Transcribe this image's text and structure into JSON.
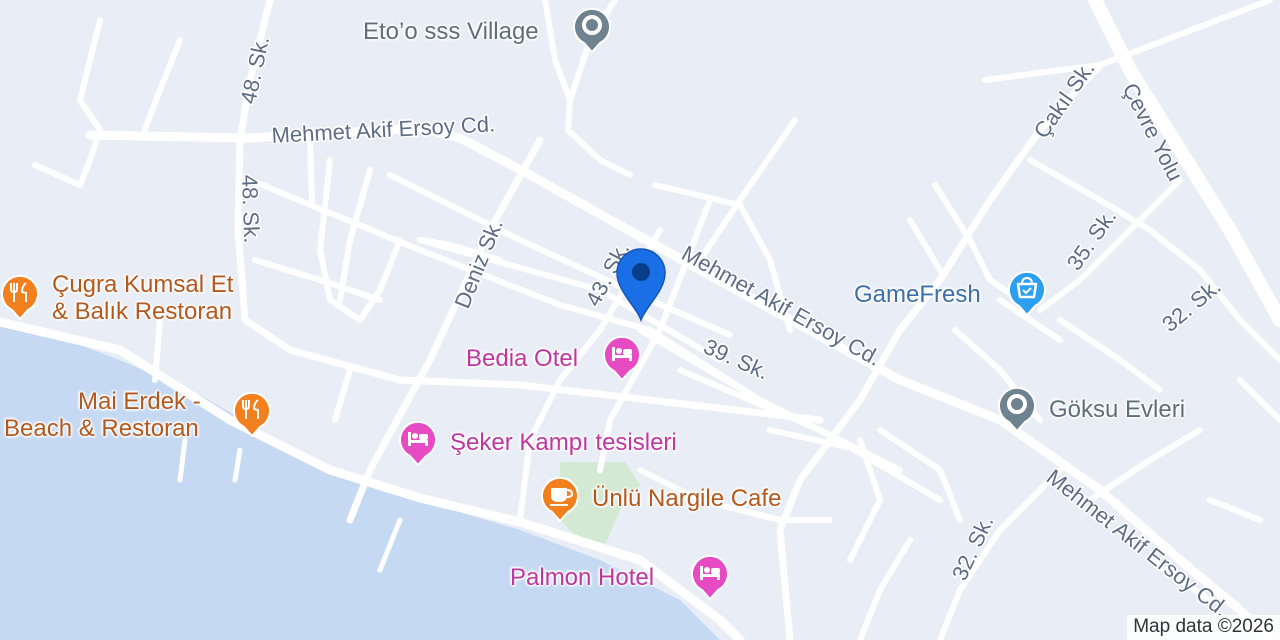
{
  "map": {
    "colors": {
      "land": "#e9edf5",
      "water": "#c6d9f3",
      "road": "#ffffff",
      "park": "#d3e9d4",
      "road_label": "#5d6d85",
      "restaurant": "#f2801f",
      "hotel": "#e64bc4",
      "landmark": "#6f828f",
      "shopping": "#2d9ff0",
      "marker": "#1a6fe6"
    },
    "road_labels": {
      "mehmet_akif_1": "Mehmet Akif Ersoy Cd.",
      "mehmet_akif_2": "Mehmet Akif Ersoy Cd.",
      "mehmet_akif_3": "Mehmet Akif Ersoy Cd.",
      "cevre_yolu": "Çevre Yolu",
      "cakil_sk": "Çakıl Sk.",
      "sk_48_top": "48. Sk.",
      "sk_48_mid": "48. Sk.",
      "deniz_sk": "Deniz Sk.",
      "sk_43": "43. Sk.",
      "sk_39": "39. Sk.",
      "sk_35": "35. Sk.",
      "sk_32_right": "32. Sk.",
      "sk_32_bottom": "32. Sk."
    },
    "pois": {
      "etoo": {
        "name": "Eto’o sss Village",
        "icon": "landmark-pin-icon",
        "category": "landmark"
      },
      "cugra": {
        "name_line1": "Çugra Kumsal Et",
        "name_line2": "& Balık Restoran",
        "icon": "restaurant-icon",
        "category": "restaurant"
      },
      "mai_erdek": {
        "name_line1": "Mai Erdek -",
        "name_line2": "Beach & Restoran",
        "icon": "restaurant-icon",
        "category": "restaurant"
      },
      "bedia": {
        "name": "Bedia Otel",
        "icon": "hotel-icon",
        "category": "hotel"
      },
      "seker": {
        "name": "Şeker Kampı tesisleri",
        "icon": "hotel-icon",
        "category": "hotel"
      },
      "nargile": {
        "name": "Ünlü Nargile Cafe",
        "icon": "cafe-icon",
        "category": "cafe"
      },
      "palmon": {
        "name": "Palmon Hotel",
        "icon": "hotel-icon",
        "category": "hotel"
      },
      "gamefresh": {
        "name": "GameFresh",
        "icon": "shopping-bag-icon",
        "category": "shopping"
      },
      "goksu": {
        "name": "Göksu Evleri",
        "icon": "landmark-pin-icon",
        "category": "landmark"
      }
    },
    "attribution": "Map data ©2026"
  }
}
